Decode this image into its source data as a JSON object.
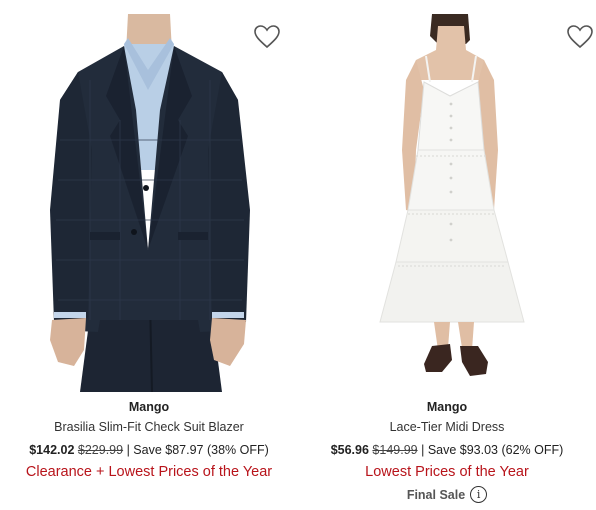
{
  "products": [
    {
      "brand": "Mango",
      "name": "Brasilia Slim-Fit Check Suit Blazer",
      "price_current": "$142.02",
      "price_original": "$229.99",
      "savings": "| Save $87.97 (38% OFF)",
      "promo": "Clearance + Lowest Prices of the Year",
      "image_icon": "blazer-photo",
      "favorite_icon": "heart-icon"
    },
    {
      "brand": "Mango",
      "name": "Lace-Tier Midi Dress",
      "price_current": "$56.96",
      "price_original": "$149.99",
      "savings": "| Save $93.03 (62% OFF)",
      "promo": "Lowest Prices of the Year",
      "final_sale": "Final Sale",
      "image_icon": "dress-photo",
      "favorite_icon": "heart-icon"
    }
  ],
  "colors": {
    "promo": "#b8141b",
    "text": "#222222"
  }
}
